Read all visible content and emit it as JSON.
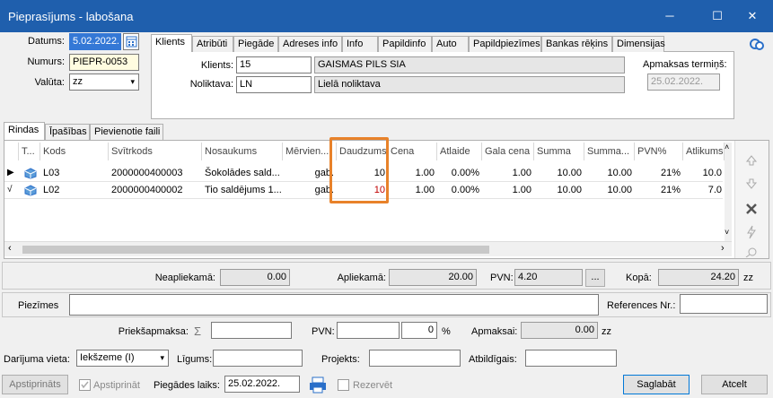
{
  "window": {
    "title": "Pieprasījums - labošana",
    "minimize": "─",
    "maximize": "☐",
    "close": "✕"
  },
  "header": {
    "date_label": "Datums:",
    "date_value": "5.02.2022.",
    "number_label": "Numurs:",
    "number_value": "PIEPR-0053",
    "currency_label": "Valūta:",
    "currency_value": "zz"
  },
  "top_tabs": [
    "Klients",
    "Atribūti",
    "Piegāde",
    "Adreses info",
    "Info",
    "Papildinfo",
    "Auto",
    "Papildpiezīmes",
    "Bankas rēķins",
    "Dimensijas"
  ],
  "client": {
    "client_label": "Klients:",
    "client_code": "15",
    "client_name": "GAISMAS PILS SIA",
    "warehouse_label": "Noliktava:",
    "warehouse_code": "LN",
    "warehouse_name": "Lielā noliktava",
    "payment_label": "Apmaksas termiņš:",
    "payment_value": "25.02.2022."
  },
  "sub_tabs": [
    "Rindas",
    "Īpašības",
    "Pievienotie faili"
  ],
  "grid": {
    "columns": [
      "T...",
      "Kods",
      "Svītrkods",
      "Nosaukums",
      "Mērvien...",
      "Daudzums",
      "Cena",
      "Atlaide",
      "Gala cena",
      "Summa",
      "Summa...",
      "PVN%",
      "Atlikums"
    ],
    "rows": [
      {
        "marker": "▶",
        "code": "L03",
        "barcode": "2000000400003",
        "name": "Šokolādes sald...",
        "unit": "gab.",
        "qty": "10",
        "price": "1.00",
        "discount": "0.00%",
        "final": "1.00",
        "sum": "10.00",
        "sum2": "10.00",
        "vat": "21%",
        "stock": "10.0"
      },
      {
        "marker": "√",
        "code": "L02",
        "barcode": "2000000400002",
        "name": "Tio saldējums 1...",
        "unit": "gab.",
        "qty": "10",
        "price": "1.00",
        "discount": "0.00%",
        "final": "1.00",
        "sum": "10.00",
        "sum2": "10.00",
        "vat": "21%",
        "stock": "7.0"
      }
    ]
  },
  "totals": {
    "non_taxable_label": "Neapliekamā:",
    "non_taxable": "0.00",
    "taxable_label": "Apliekamā:",
    "taxable": "20.00",
    "vat_label": "PVN:",
    "vat": "4.20",
    "ellipsis": "...",
    "total_label": "Kopā:",
    "total": "24.20",
    "currency": "zz"
  },
  "notes_label": "Piezīmes",
  "references_label": "References Nr.:",
  "prepay": {
    "label": "Priekšapmaksa:",
    "sigma": "Σ",
    "vat_label": "PVN:",
    "vat_value": "0",
    "percent": "%",
    "paid_label": "Apmaksai:",
    "paid_value": "0.00",
    "currency": "zz"
  },
  "deal": {
    "place_label": "Darījuma vieta:",
    "place_value": "Iekšzeme (I)",
    "contract_label": "Līgums:",
    "project_label": "Projekts:",
    "responsible_label": "Atbildīgais:"
  },
  "footer": {
    "approve_btn": "Apstiprināts",
    "approve_chk": "Apstiprināt",
    "delivery_label": "Piegādes laiks:",
    "delivery_value": "25.02.2022.",
    "reserve": "Rezervēt",
    "save": "Saglabāt",
    "cancel": "Atcelt"
  },
  "colors": {
    "titlebar": "#1f5fad",
    "highlight": "#e8822a",
    "qty_red": "#c00000"
  }
}
